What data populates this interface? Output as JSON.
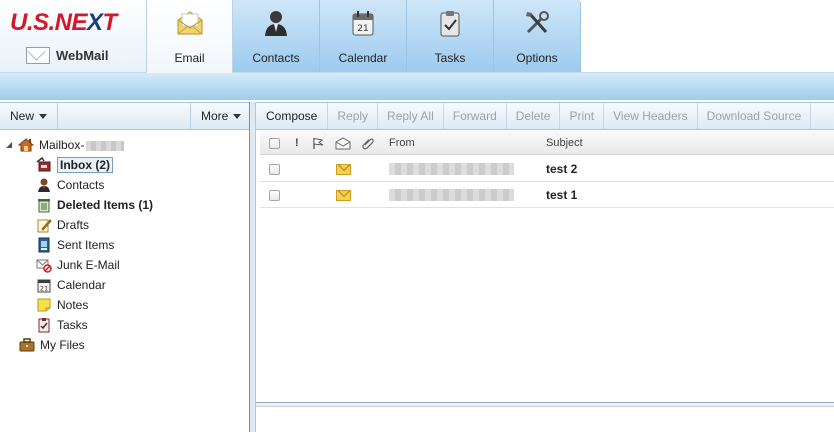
{
  "brand": {
    "logo_left": "U.S.NE",
    "logo_x": "X",
    "logo_right": "T",
    "product": "WebMail"
  },
  "tabs": [
    {
      "label": "Email",
      "icon": "envelope-icon",
      "active": true
    },
    {
      "label": "Contacts",
      "icon": "person-icon",
      "active": false
    },
    {
      "label": "Calendar",
      "icon": "calendar-icon",
      "active": false
    },
    {
      "label": "Tasks",
      "icon": "clipboard-icon",
      "active": false
    },
    {
      "label": "Options",
      "icon": "tools-icon",
      "active": false
    }
  ],
  "left_toolbar": {
    "new_label": "New",
    "more_label": "More"
  },
  "tree": {
    "root_label": "Mailbox-",
    "items": [
      {
        "label": "Inbox (2)",
        "icon": "inbox-icon"
      },
      {
        "label": "Contacts",
        "icon": "contacts-icon"
      },
      {
        "label": "Deleted Items (1)",
        "icon": "trash-icon"
      },
      {
        "label": "Drafts",
        "icon": "drafts-icon"
      },
      {
        "label": "Sent Items",
        "icon": "sent-icon"
      },
      {
        "label": "Junk E-Mail",
        "icon": "junk-icon"
      },
      {
        "label": "Calendar",
        "icon": "calendar-icon"
      },
      {
        "label": "Notes",
        "icon": "note-icon"
      },
      {
        "label": "Tasks",
        "icon": "tasks-icon"
      }
    ],
    "my_files_label": "My Files"
  },
  "toolbar": {
    "compose": "Compose",
    "reply": "Reply",
    "reply_all": "Reply All",
    "forward": "Forward",
    "delete": "Delete",
    "print": "Print",
    "view_headers": "View Headers",
    "download_source": "Download Source"
  },
  "list": {
    "columns": {
      "importance": "!",
      "from": "From",
      "subject": "Subject"
    },
    "rows": [
      {
        "subject": "test 2",
        "unread": true
      },
      {
        "subject": "test 1",
        "unread": true
      }
    ]
  },
  "colors": {
    "brand_red": "#d2182a",
    "brand_blue": "#1c3f7c",
    "tab_blue": "#9ccbee",
    "envelope": "#f7cf4d"
  }
}
